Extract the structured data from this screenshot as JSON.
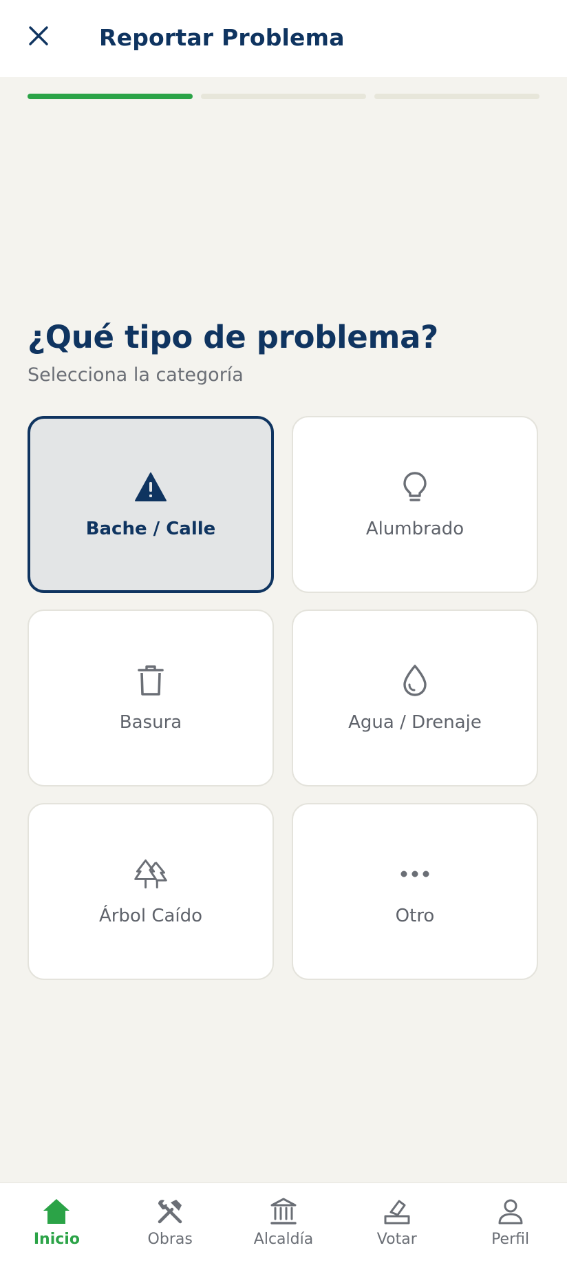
{
  "header": {
    "title": "Reportar Problema",
    "close_icon": "close-icon"
  },
  "progress": {
    "total_steps": 3,
    "current_step": 1,
    "active_color": "#2BA347",
    "inactive_color": "#E7E6DA"
  },
  "main": {
    "question": "¿Qué tipo de problema?",
    "subtitle": "Selecciona la categoría",
    "categories": [
      {
        "label": "Bache / Calle",
        "icon": "warning-icon",
        "selected": true
      },
      {
        "label": "Alumbrado",
        "icon": "lightbulb-icon",
        "selected": false
      },
      {
        "label": "Basura",
        "icon": "trash-icon",
        "selected": false
      },
      {
        "label": "Agua / Drenaje",
        "icon": "water-drop-icon",
        "selected": false
      },
      {
        "label": "Árbol Caído",
        "icon": "trees-icon",
        "selected": false
      },
      {
        "label": "Otro",
        "icon": "more-icon",
        "selected": false
      }
    ]
  },
  "bottom_nav": {
    "items": [
      {
        "label": "Inicio",
        "icon": "home-icon",
        "active": true
      },
      {
        "label": "Obras",
        "icon": "tools-icon",
        "active": false
      },
      {
        "label": "Alcaldía",
        "icon": "city-hall-icon",
        "active": false
      },
      {
        "label": "Votar",
        "icon": "vote-icon",
        "active": false
      },
      {
        "label": "Perfil",
        "icon": "person-icon",
        "active": false
      }
    ]
  },
  "colors": {
    "primary": "#0F3460",
    "accent": "#2BA347",
    "background": "#F4F3EE",
    "muted_text": "#6B6F76"
  }
}
